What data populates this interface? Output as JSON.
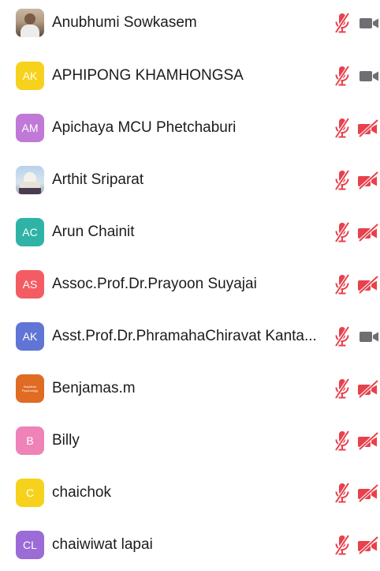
{
  "colors": {
    "muted_red": "#e8414c",
    "camera_on_gray": "#6e6e73",
    "text": "#1c1c1e"
  },
  "participants": [
    {
      "name": "Anubhumi Sowkasem",
      "avatar": {
        "type": "photo",
        "initials": ""
      },
      "mic": "muted",
      "camera": "on"
    },
    {
      "name": "APHIPONG KHAMHONGSA",
      "avatar": {
        "type": "initials",
        "initials": "AK",
        "color": "#f7d21c"
      },
      "mic": "muted",
      "camera": "on"
    },
    {
      "name": "Apichaya MCU Phetchaburi",
      "avatar": {
        "type": "initials",
        "initials": "AM",
        "color": "#c079d6"
      },
      "mic": "muted",
      "camera": "off"
    },
    {
      "name": "Arthit Sriparat",
      "avatar": {
        "type": "temple",
        "initials": ""
      },
      "mic": "muted",
      "camera": "off"
    },
    {
      "name": "Arun Chainit",
      "avatar": {
        "type": "initials",
        "initials": "AC",
        "color": "#2fb3a6"
      },
      "mic": "muted",
      "camera": "off"
    },
    {
      "name": "Assoc.Prof.Dr.Prayoon Suyajai",
      "avatar": {
        "type": "initials",
        "initials": "AS",
        "color": "#f45c63"
      },
      "mic": "muted",
      "camera": "off"
    },
    {
      "name": "Asst.Prof.Dr.PhramahaChiravat  Kanta...",
      "avatar": {
        "type": "initials",
        "initials": "AK",
        "color": "#6175d6"
      },
      "mic": "muted",
      "camera": "on"
    },
    {
      "name": "Benjamas.m",
      "avatar": {
        "type": "book",
        "initials": "Buddhist Psychology"
      },
      "mic": "muted",
      "camera": "off"
    },
    {
      "name": "Billy",
      "avatar": {
        "type": "initials",
        "initials": "B",
        "color": "#ee83b8"
      },
      "mic": "muted",
      "camera": "off"
    },
    {
      "name": "chaichok",
      "avatar": {
        "type": "initials",
        "initials": "C",
        "color": "#f7d21c"
      },
      "mic": "muted",
      "camera": "off"
    },
    {
      "name": "chaiwiwat lapai",
      "avatar": {
        "type": "initials",
        "initials": "CL",
        "color": "#9b6bd6"
      },
      "mic": "muted",
      "camera": "off"
    }
  ]
}
